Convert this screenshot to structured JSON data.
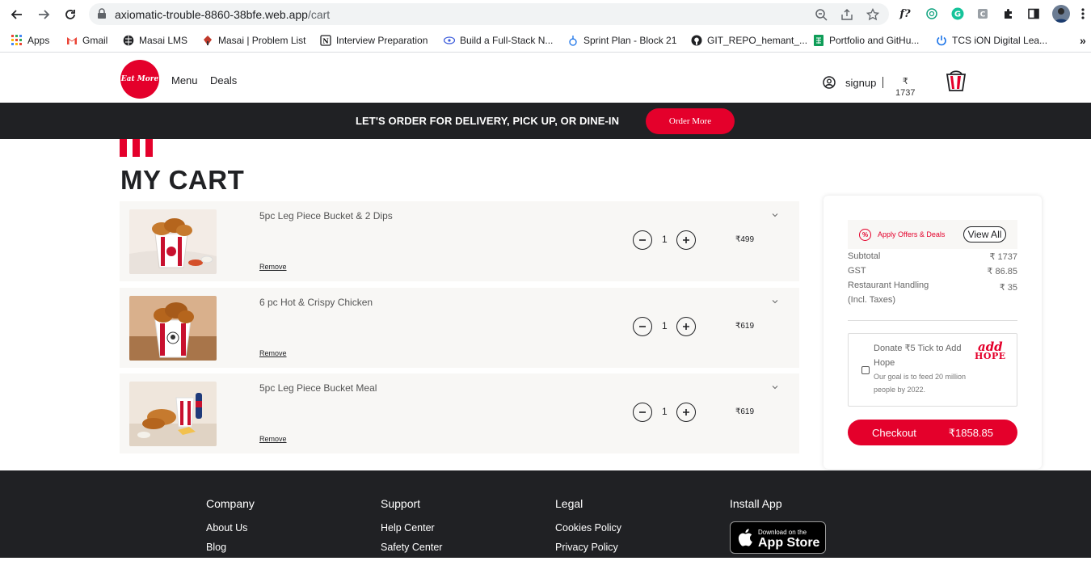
{
  "browser": {
    "url_host": "axiomatic-trouble-8860-38bfe.web.app",
    "url_path": "/cart",
    "bookmarks": [
      {
        "label": "Apps",
        "icon": "apps-grid-icon"
      },
      {
        "label": "Gmail",
        "icon": "gmail-icon"
      },
      {
        "label": "Masai LMS",
        "icon": "globe-icon"
      },
      {
        "label": "Masai | Problem List",
        "icon": "masai-icon"
      },
      {
        "label": "Interview Preparation",
        "icon": "notion-icon"
      },
      {
        "label": "Build a Full-Stack N...",
        "icon": "build-icon"
      },
      {
        "label": "Sprint Plan - Block 21",
        "icon": "sprint-icon"
      },
      {
        "label": "GIT_REPO_hemant_...",
        "icon": "github-icon"
      },
      {
        "label": "Portfolio and GitHu...",
        "icon": "sheets-icon"
      },
      {
        "label": "TCS iON Digital Lea...",
        "icon": "power-icon"
      }
    ],
    "more_bookmarks": "»",
    "ext_fx": "f?"
  },
  "header": {
    "logo_text": "Eat More",
    "nav": [
      {
        "label": "Menu"
      },
      {
        "label": "Deals"
      }
    ],
    "signup_label": "signup",
    "currency": "₹",
    "cart_total": "1737"
  },
  "promo": {
    "text": "LET'S ORDER FOR DELIVERY, PICK UP, OR DINE-IN",
    "button": "Order More"
  },
  "cart": {
    "title": "MY CART",
    "remove_label": "Remove",
    "items": [
      {
        "name": "5pc Leg Piece Bucket & 2 Dips",
        "qty": "1",
        "price": "₹499"
      },
      {
        "name": "6 pc Hot & Crispy Chicken",
        "qty": "1",
        "price": "₹619"
      },
      {
        "name": "5pc Leg Piece Bucket Meal",
        "qty": "1",
        "price": "₹619"
      }
    ]
  },
  "summary": {
    "offers_label": "Apply Offers & Deals",
    "view_all": "View All",
    "subtotal_label": "Subtotal",
    "subtotal": "₹ 1737",
    "gst_label": "GST",
    "gst": "₹ 86.85",
    "handling_label": "Restaurant Handling (Incl. Taxes)",
    "handling": "₹ 35",
    "donate_text": "Donate ₹5 Tick to Add Hope",
    "donate_sub": "Our goal is to feed 20 million people by 2022.",
    "addhope_a": "add",
    "addhope_h": "HOPE",
    "checkout_label": "Checkout",
    "checkout_total": "₹1858.85"
  },
  "footer": {
    "columns": [
      {
        "heading": "Company",
        "links": [
          "About Us",
          "Blog"
        ]
      },
      {
        "heading": "Support",
        "links": [
          "Help Center",
          "Safety Center"
        ]
      },
      {
        "heading": "Legal",
        "links": [
          "Cookies Policy",
          "Privacy Policy"
        ]
      },
      {
        "heading": "Install App",
        "links": []
      }
    ],
    "appstore_small": "Download on the",
    "appstore_big": "App Store"
  },
  "colors": {
    "brand_red": "#e4002b",
    "dark": "#202124"
  }
}
